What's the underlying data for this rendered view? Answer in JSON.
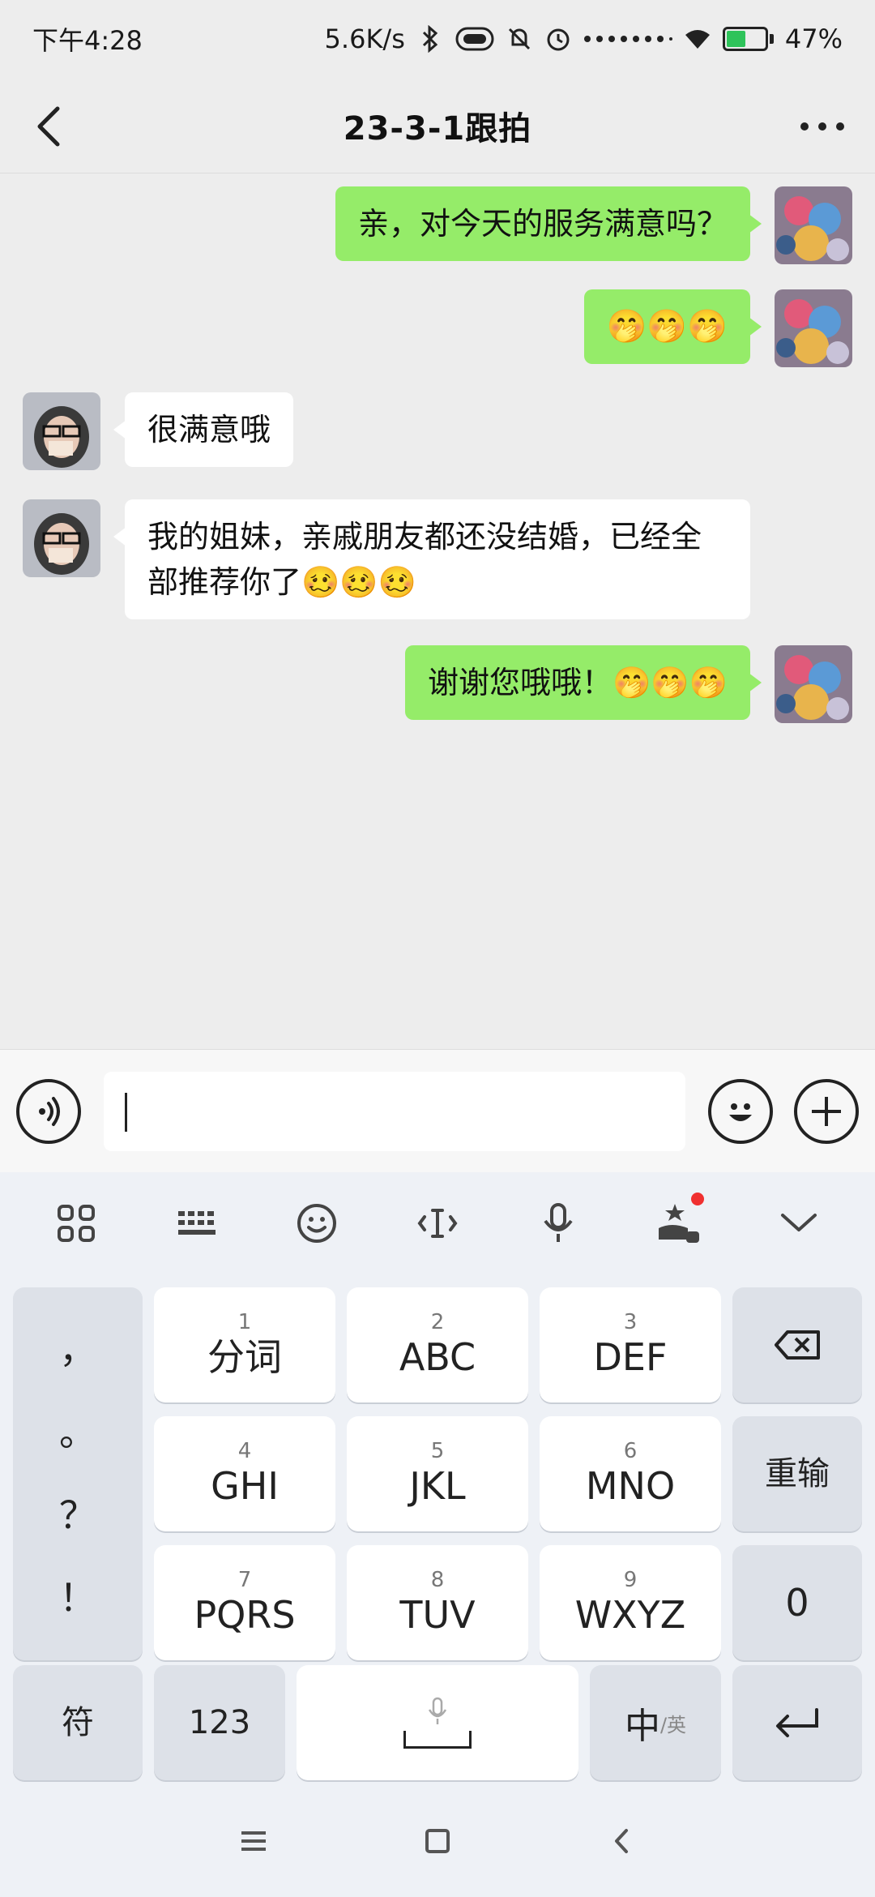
{
  "status_bar": {
    "time": "下午4:28",
    "net_speed": "5.6K/s",
    "battery_level": 0.47,
    "battery_text": "47%",
    "icons": [
      "bluetooth-icon",
      "toggle-icon",
      "mute-icon",
      "alarm-icon",
      "signal-dots-icon",
      "wifi-icon",
      "battery-icon"
    ]
  },
  "header": {
    "title": "23-3-1跟拍",
    "back_icon": "back-arrow-icon",
    "more_icon": "more-dots-icon"
  },
  "messages": [
    {
      "side": "out",
      "text": "亲，对今天的服务满意吗？"
    },
    {
      "side": "out",
      "text": "🤭🤭🤭"
    },
    {
      "side": "in",
      "text": "很满意哦"
    },
    {
      "side": "in",
      "text": "我的姐妹，亲戚朋友都还没结婚，已经全部推荐你了🥴🥴🥴"
    },
    {
      "side": "out",
      "text": "谢谢您哦哦！🤭🤭🤭"
    }
  ],
  "input_bar": {
    "voice_icon": "voice-icon",
    "emoji_icon": "emoji-icon",
    "plus_icon": "plus-icon",
    "value": ""
  },
  "keyboard": {
    "toolbar_icons": [
      "apps-grid-icon",
      "keyboard-icon",
      "emoji-icon",
      "cursor-icon",
      "mic-icon",
      "skin-icon",
      "collapse-icon"
    ],
    "punct": [
      "，",
      "。",
      "？",
      "！"
    ],
    "keys": [
      {
        "num": "1",
        "label": "分词"
      },
      {
        "num": "2",
        "label": "ABC"
      },
      {
        "num": "3",
        "label": "DEF"
      },
      {
        "num": "4",
        "label": "GHI"
      },
      {
        "num": "5",
        "label": "JKL"
      },
      {
        "num": "6",
        "label": "MNO"
      },
      {
        "num": "7",
        "label": "PQRS"
      },
      {
        "num": "8",
        "label": "TUV"
      },
      {
        "num": "9",
        "label": "WXYZ"
      }
    ],
    "reenter_label": "重输",
    "zero_label": "0",
    "symbol_label": "符",
    "num_label": "123",
    "lang_main": "中",
    "lang_sub": "/英"
  },
  "nav": [
    "menu-icon",
    "home-icon",
    "back-icon"
  ]
}
